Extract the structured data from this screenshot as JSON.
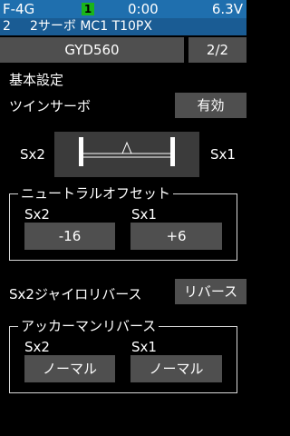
{
  "status": {
    "model": "F-4G",
    "model_number": "1",
    "timer": "0:00",
    "voltage": "6.3V"
  },
  "subheader": {
    "channel": "2",
    "info": "2サーボ MC1 T10PX"
  },
  "gyro_button": {
    "label": "GYD560"
  },
  "page_indicator": "2/2",
  "section_title": "基本設定",
  "twin_servo": {
    "label": "ツインサーボ",
    "value": "有効"
  },
  "servo_display": {
    "left_label": "Sx2",
    "right_label": "Sx1"
  },
  "neutral_offset": {
    "title": "ニュートラルオフセット",
    "left_label": "Sx2",
    "right_label": "Sx1",
    "left_value": "-16",
    "right_value": "+6"
  },
  "sx2_gyro_reverse": {
    "label": "Sx2ジャイロリバース",
    "value": "リバース"
  },
  "ackerman_reverse": {
    "title": "アッカーマンリバース",
    "left_label": "Sx2",
    "right_label": "Sx1",
    "left_value": "ノーマル",
    "right_value": "ノーマル"
  },
  "colors": {
    "status_bar": "#1f6fae",
    "sub_bar": "#1a5c94",
    "button": "#4f4f4f",
    "badge": "#1ab51a"
  }
}
